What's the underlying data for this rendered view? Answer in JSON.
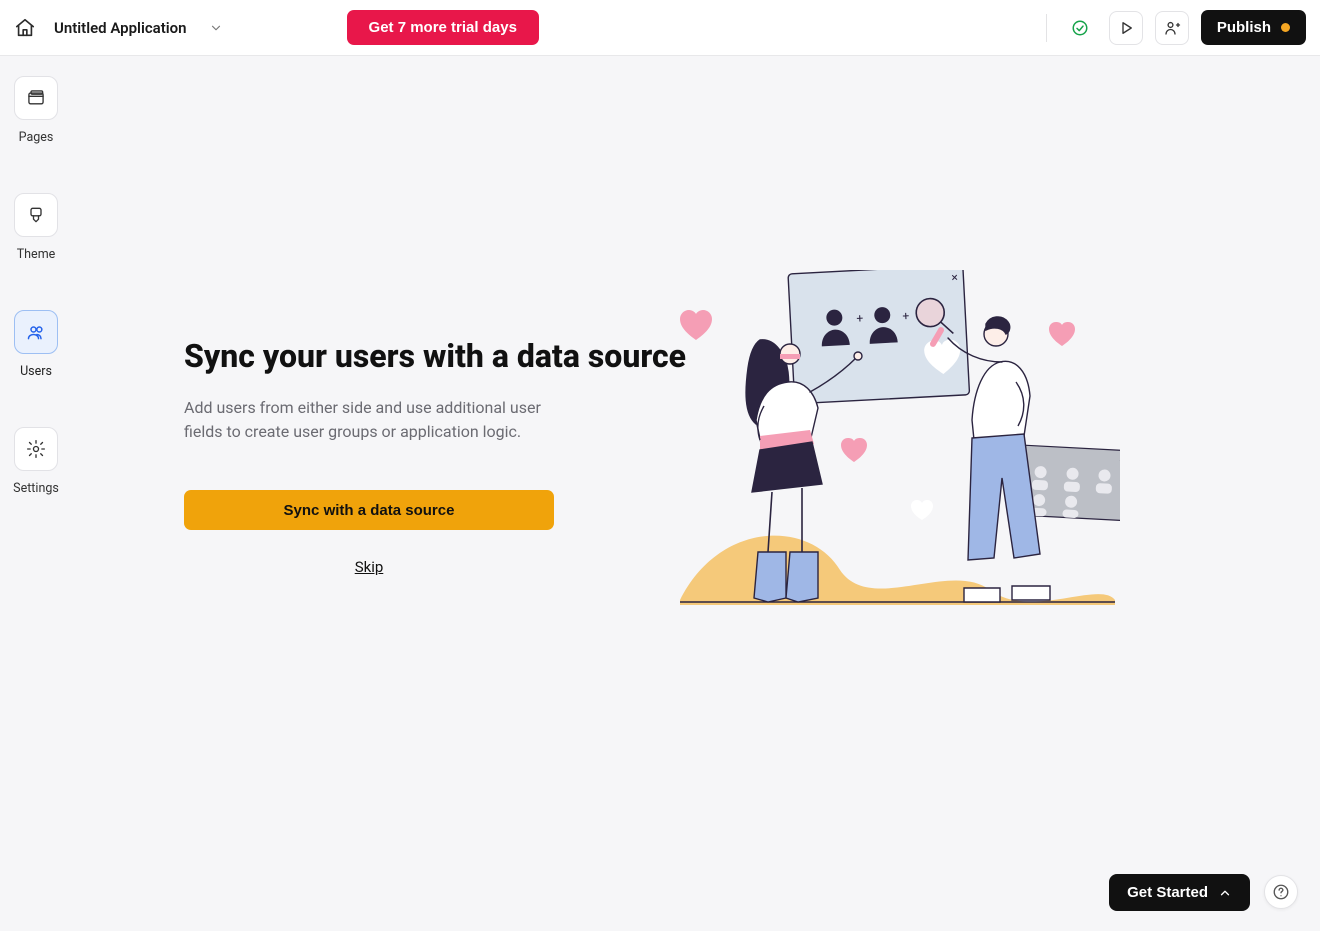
{
  "header": {
    "app_title": "Untitled Application",
    "trial_button": "Get 7 more trial days",
    "publish_button": "Publish"
  },
  "sidebar": {
    "items": [
      {
        "label": "Pages",
        "icon": "browser-icon",
        "active": false
      },
      {
        "label": "Theme",
        "icon": "brush-icon",
        "active": false
      },
      {
        "label": "Users",
        "icon": "users-icon",
        "active": true
      },
      {
        "label": "Settings",
        "icon": "gear-icon",
        "active": false
      }
    ]
  },
  "main": {
    "title": "Sync your users with a data source",
    "description": "Add users from either side and use additional user fields to create user groups or application logic.",
    "sync_button": "Sync with a data source",
    "skip_link": "Skip"
  },
  "bottom": {
    "get_started": "Get Started"
  },
  "colors": {
    "accent_pink": "#e8174a",
    "accent_orange": "#f0a30b",
    "dark": "#111111",
    "status_dot": "#f5a623",
    "active_blue": "#2563eb"
  }
}
